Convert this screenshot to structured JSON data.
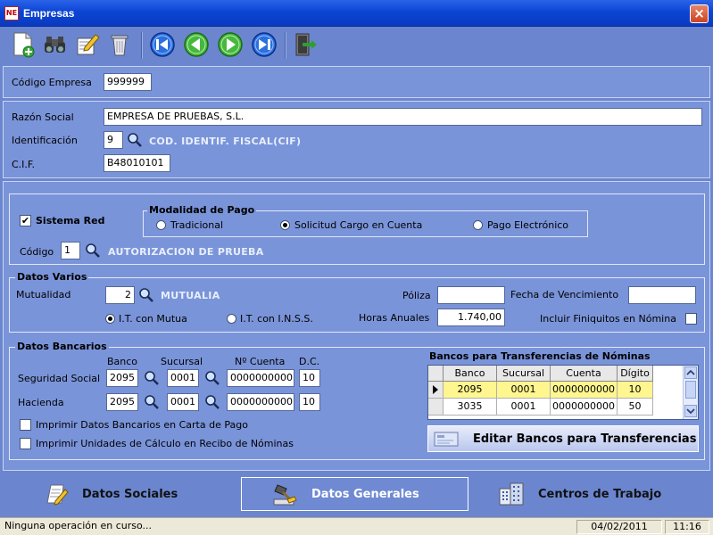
{
  "window": {
    "title": "Empresas",
    "icon_text": "NE"
  },
  "toolbar": {
    "buttons": [
      "new-document-icon",
      "binoculars-icon",
      "edit-icon",
      "delete-icon",
      "first-record-icon",
      "previous-record-icon",
      "next-record-icon",
      "last-record-icon",
      "exit-icon"
    ]
  },
  "codigo_empresa": {
    "label": "Código Empresa",
    "value": "999999"
  },
  "company": {
    "razon_social_label": "Razón Social",
    "razon_social_value": "EMPRESA DE PRUEBAS, S.L.",
    "identificacion_label": "Identificación",
    "identificacion_value": "9",
    "identificacion_desc": "COD. IDENTIF. FISCAL(CIF)",
    "cif_label": "C.I.F.",
    "cif_value": "B48010101"
  },
  "sistema_red": {
    "label": "Sistema Red",
    "checked": true,
    "codigo_label": "Código",
    "codigo_value": "1",
    "codigo_desc": "AUTORIZACION  DE PRUEBA"
  },
  "modalidad_pago": {
    "title": "Modalidad de Pago",
    "options": [
      "Tradicional",
      "Solicitud Cargo en Cuenta",
      "Pago Electrónico"
    ],
    "selected": "Solicitud Cargo en Cuenta"
  },
  "datos_varios": {
    "title": "Datos Varios",
    "mutualidad_label": "Mutualidad",
    "mutualidad_value": "2",
    "mutualidad_desc": "MUTUALIA",
    "it_mutua": "I.T. con Mutua",
    "it_inss": "I.T. con I.N.S.S.",
    "it_selected": "I.T. con Mutua",
    "poliza_label": "Póliza",
    "poliza_value": "",
    "fecha_venc_label": "Fecha de Vencimiento",
    "fecha_venc_value": "",
    "horas_label": "Horas Anuales",
    "horas_value": "1.740,00",
    "finiquitos_label": "Incluir Finiquitos en Nómina",
    "finiquitos_checked": false
  },
  "datos_bancarios": {
    "title": "Datos Bancarios",
    "headers": {
      "banco": "Banco",
      "sucursal": "Sucursal",
      "cuenta": "Nº Cuenta",
      "dc": "D.C."
    },
    "seguridad_social": {
      "label": "Seguridad Social",
      "banco": "2095",
      "sucursal": "0001",
      "cuenta": "0000000000",
      "dc": "10"
    },
    "hacienda": {
      "label": "Hacienda",
      "banco": "2095",
      "sucursal": "0001",
      "cuenta": "0000000000",
      "dc": "10"
    },
    "imprimir_carta_label": "Imprimir Datos Bancarios en Carta de Pago",
    "imprimir_recibo_label": "Imprimir Unidades de Cálculo en Recibo de Nóminas"
  },
  "bancos_transferencias": {
    "title": "Bancos para Transferencias de Nóminas",
    "columns": [
      "Banco",
      "Sucursal",
      "Cuenta",
      "Dígito"
    ],
    "rows": [
      [
        "2095",
        "0001",
        "0000000000",
        "10"
      ],
      [
        "3035",
        "0001",
        "0000000000",
        "50"
      ]
    ],
    "edit_button": "Editar Bancos para Transferencias"
  },
  "nav": {
    "datos_sociales": "Datos Sociales",
    "datos_generales": "Datos Generales",
    "centros_trabajo": "Centros de Trabajo"
  },
  "statusbar": {
    "message": "Ninguna operación en curso...",
    "date": "04/02/2011",
    "time": "11:16"
  }
}
